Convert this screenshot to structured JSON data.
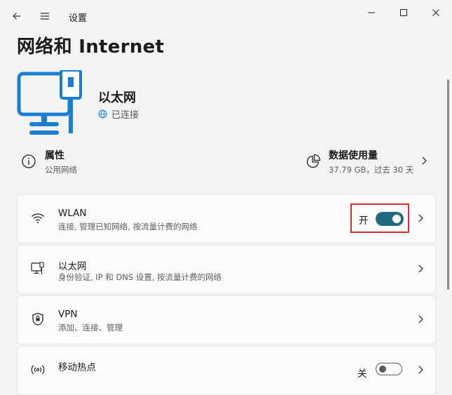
{
  "app": {
    "title": "设置"
  },
  "page": {
    "title": "网络和 Internet"
  },
  "hero": {
    "name": "以太网",
    "status": "已连接"
  },
  "properties": {
    "title": "属性",
    "subtitle": "公用网络"
  },
  "data_usage": {
    "title": "数据使用量",
    "subtitle": "37.79 GB，过去 30 天"
  },
  "cards": [
    {
      "title": "WLAN",
      "subtitle": "连接, 管理已知网络, 按流量计费的网络",
      "toggle_label": "开",
      "toggle_on": true
    },
    {
      "title": "以太网",
      "subtitle": "身份验证, IP 和 DNS 设置, 按流量计费的网络"
    },
    {
      "title": "VPN",
      "subtitle": "添加、连接、管理"
    },
    {
      "title": "移动热点",
      "toggle_label": "关",
      "toggle_on": false
    }
  ],
  "colors": {
    "accent": "#0078d4",
    "toggle_on": "#1f6a7f",
    "highlight_border": "#d32f2f"
  }
}
